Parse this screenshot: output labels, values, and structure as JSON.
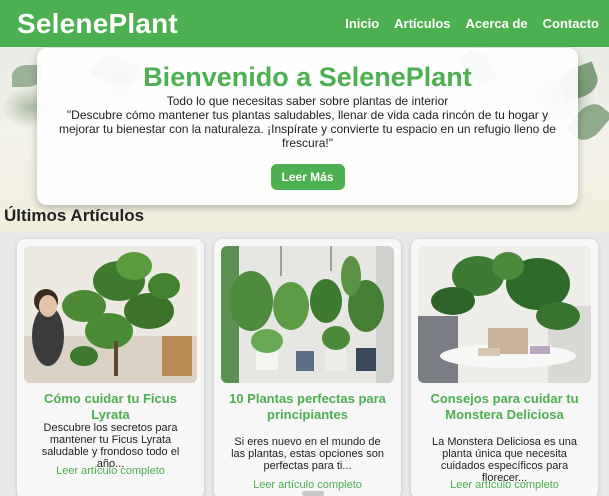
{
  "nav": {
    "brand": "SelenePlant",
    "links": [
      "Inicio",
      "Artículos",
      "Acerca de",
      "Contacto"
    ]
  },
  "hero": {
    "title": "Bienvenido a SelenePlant",
    "subtitle": "Todo lo que necesitas saber sobre plantas de interior",
    "quote": "\"Descubre cómo mantener tus plantas saludables, llenar de vida cada rincón de tu hogar y mejorar tu bienestar con la naturaleza. ¡Inspírate y convierte tu espacio en un refugio lleno de frescura!\"",
    "button": "Leer Más"
  },
  "section": {
    "title": "Últimos Artículos"
  },
  "articles": [
    {
      "title": "Cómo cuidar tu Ficus Lyrata",
      "description": "Descubre los secretos para mantener tu Ficus Lyrata saludable y frondoso todo el año...",
      "link": "Leer artículo completo",
      "image_icon": "ficus-photo"
    },
    {
      "title": "10 Plantas perfectas para principiantes",
      "description": "Si eres nuevo en el mundo de las plantas, estas opciones son perfectas para ti...",
      "link": "Leer artículo completo",
      "image_icon": "shelf-plants-photo"
    },
    {
      "title": "Consejos para cuidar tu Monstera Deliciosa",
      "description": "La Monstera Deliciosa es una planta única que necesita cuidados específicos para florecer...",
      "link": "Leer artículo completo",
      "image_icon": "monstera-photo"
    }
  ],
  "colors": {
    "accent": "#4caf50",
    "text": "#222222"
  }
}
